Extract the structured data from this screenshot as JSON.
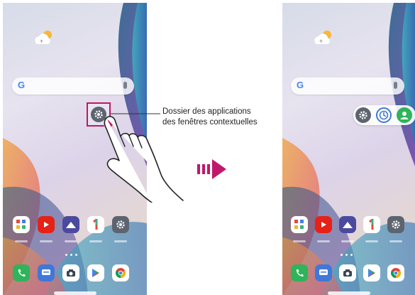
{
  "callout": {
    "line1": "Dossier des applications",
    "line2": "des fenêtres contextuelles"
  },
  "search": {
    "logo": "G"
  },
  "left_screen": {
    "folder_icon": "gear-icon",
    "dock_row1": [
      "apps-grid-icon",
      "youtube-icon",
      "gallery-icon",
      "one-icon",
      "settings-icon"
    ],
    "dock_row2": [
      "phone-icon",
      "messages-icon",
      "camera-icon",
      "play-store-icon",
      "chrome-icon"
    ]
  },
  "right_screen": {
    "popup_apps": [
      "settings-icon",
      "clock-icon",
      "contacts-icon"
    ]
  },
  "colors": {
    "highlight": "#c0186a",
    "arrow": "#c0186a"
  }
}
